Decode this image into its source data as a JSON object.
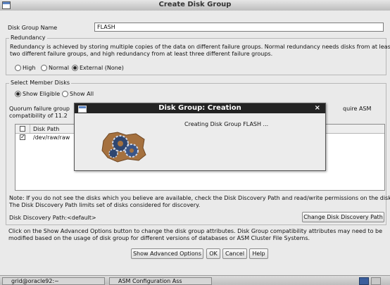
{
  "window": {
    "title": "Create Disk Group"
  },
  "disk_group_name": {
    "label": "Disk Group Name",
    "value": "FLASH"
  },
  "redundancy": {
    "legend": "Redundancy",
    "description_line1": "Redundancy is achieved by storing multiple copies of the data on different failure groups. Normal redundancy needs disks from at least",
    "description_line2": "two different failure groups, and high redundancy from at least three different failure groups.",
    "options": [
      "High",
      "Normal",
      "External (None)"
    ],
    "selected": "External (None)"
  },
  "member_disks": {
    "legend": "Select Member Disks",
    "options": [
      "Show Eligible",
      "Show All"
    ],
    "selected": "Show Eligible",
    "quorum_line1_start": "Quorum failure group",
    "quorum_line1_end": "quire ASM",
    "quorum_line2": "compatibility of 11.2",
    "table": {
      "column": "Disk Path",
      "rows": [
        {
          "checked": true,
          "path": "/dev/raw/raw"
        }
      ]
    },
    "note_line1": "Note: If you do not see the disks which you believe are available, check the Disk Discovery Path and read/write permissions on the disks.",
    "note_line2": "The Disk Discovery Path limits set of disks considered for discovery.",
    "discovery_path_label": "Disk Discovery Path:<default>",
    "change_path_button": "Change Disk Discovery Path"
  },
  "advanced": {
    "text_line1": "Click on the Show Advanced Options button to change the disk group attributes. Disk Group compatibility attributes may need to be",
    "text_line2": "modified based on the usage of disk group for different versions of databases or ASM Cluster File Systems."
  },
  "buttons": {
    "advanced": "Show Advanced Options",
    "ok": "OK",
    "cancel": "Cancel",
    "help": "Help"
  },
  "progress_dialog": {
    "title": "Disk Group: Creation",
    "close": "×",
    "message": "Creating Disk Group FLASH ...",
    "icon": "gears-icon"
  },
  "taskbar": {
    "items": [
      "grid@oracle92:~",
      "ASM Configuration Ass"
    ]
  }
}
